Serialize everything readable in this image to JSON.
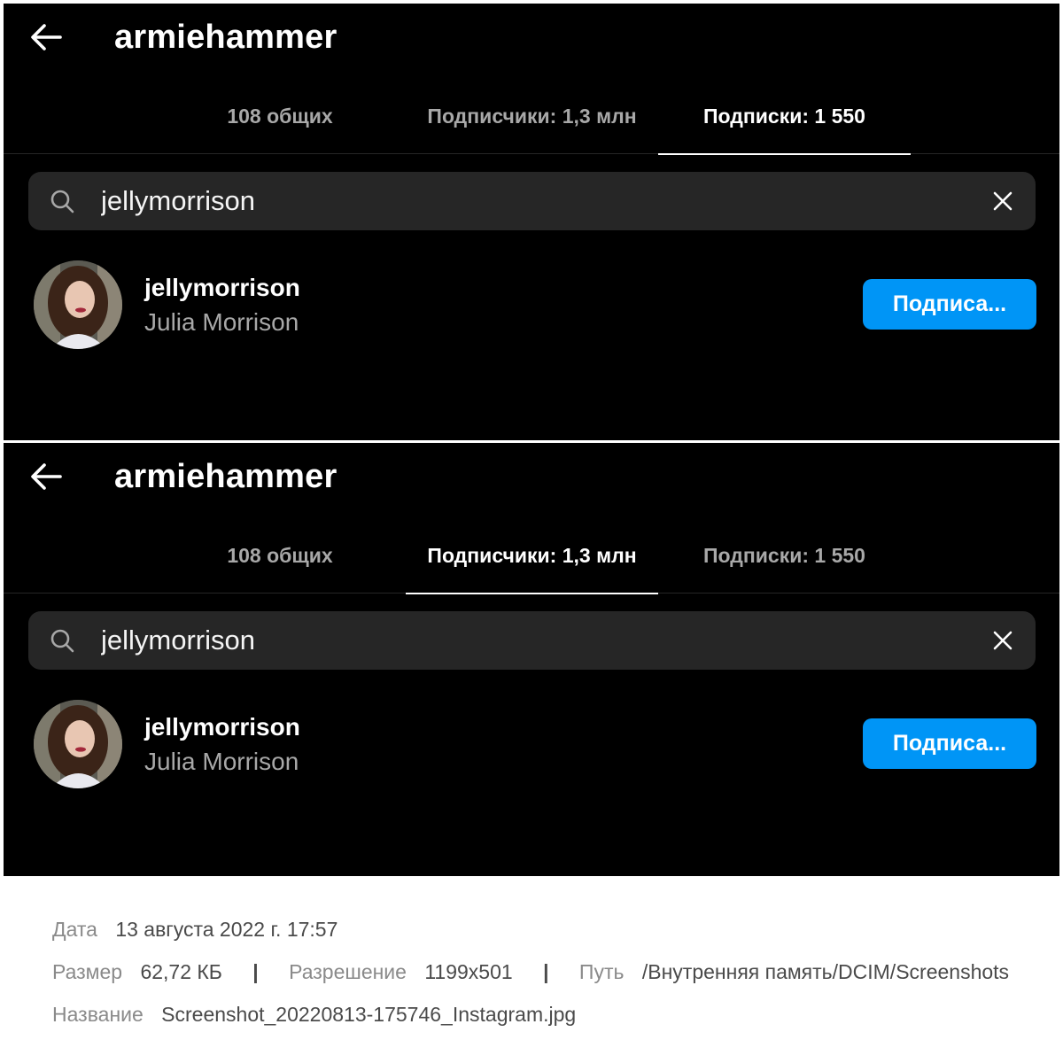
{
  "colors": {
    "panel_bg": "#000000",
    "search_bg": "#262626",
    "primary_text": "#ffffff",
    "secondary_text": "#a8a8a8",
    "follow_button": "#0095f6"
  },
  "screens": [
    {
      "title": "armiehammer",
      "back_icon": "arrow-left-icon",
      "tabs": [
        {
          "label": "108 общих",
          "active": false
        },
        {
          "label": "Подписчики: 1,3 млн",
          "active": false
        },
        {
          "label": "Подписки: 1 550",
          "active": true
        }
      ],
      "search": {
        "icon": "search-icon",
        "value": "jellymorrison",
        "clear_icon": "close-icon"
      },
      "result": {
        "username": "jellymorrison",
        "full_name": "Julia Morrison",
        "button_label": "Подписа..."
      }
    },
    {
      "title": "armiehammer",
      "back_icon": "arrow-left-icon",
      "tabs": [
        {
          "label": "108 общих",
          "active": false
        },
        {
          "label": "Подписчики: 1,3 млн",
          "active": true
        },
        {
          "label": "Подписки: 1 550",
          "active": false
        }
      ],
      "search": {
        "icon": "search-icon",
        "value": "jellymorrison",
        "clear_icon": "close-icon"
      },
      "result": {
        "username": "jellymorrison",
        "full_name": "Julia Morrison",
        "button_label": "Подписа..."
      }
    }
  ],
  "file_info": {
    "date_label": "Дата",
    "date_value": "13 августа 2022 г. 17:57",
    "size_label": "Размер",
    "size_value": "62,72 КБ",
    "resolution_label": "Разрешение",
    "resolution_value": "1199x501",
    "path_label": "Путь",
    "path_value": "/Внутренняя память/DCIM/Screenshots",
    "name_label": "Название",
    "name_value": "Screenshot_20220813-175746_Instagram.jpg",
    "separator": "|"
  }
}
